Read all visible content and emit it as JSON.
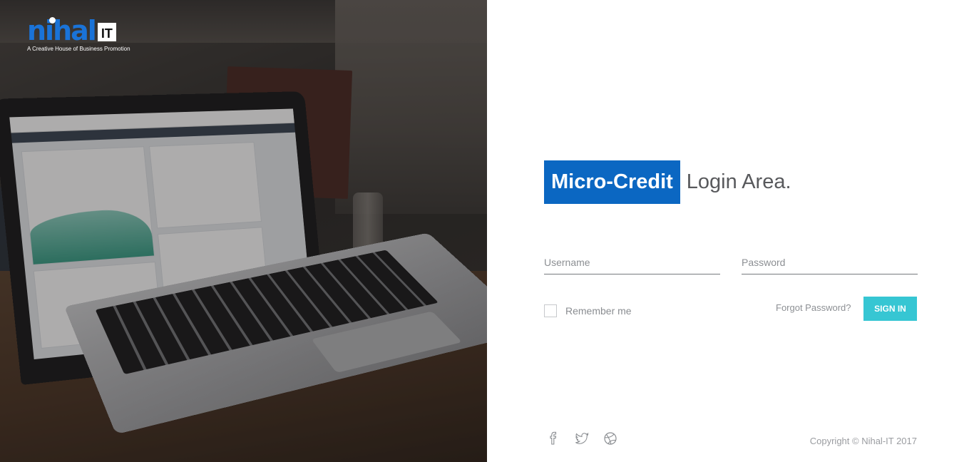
{
  "logo": {
    "name": "nihal",
    "suffix": "IT",
    "tagline": "A Creative House of Business Promotion"
  },
  "login": {
    "brand": "Micro-Credit",
    "title_rest": "Login Area.",
    "username_placeholder": "Username",
    "password_placeholder": "Password",
    "remember_label": "Remember me",
    "forgot_label": "Forgot Password?",
    "signin_label": "SIGN IN"
  },
  "social": [
    "facebook-icon",
    "twitter-icon",
    "dribbble-icon"
  ],
  "footer": {
    "copyright": "Copyright © Nihal-IT 2017"
  },
  "colors": {
    "brand_blue": "#0b67c2",
    "signin_cyan": "#36c6d3",
    "logo_blue": "#1a73d8"
  }
}
